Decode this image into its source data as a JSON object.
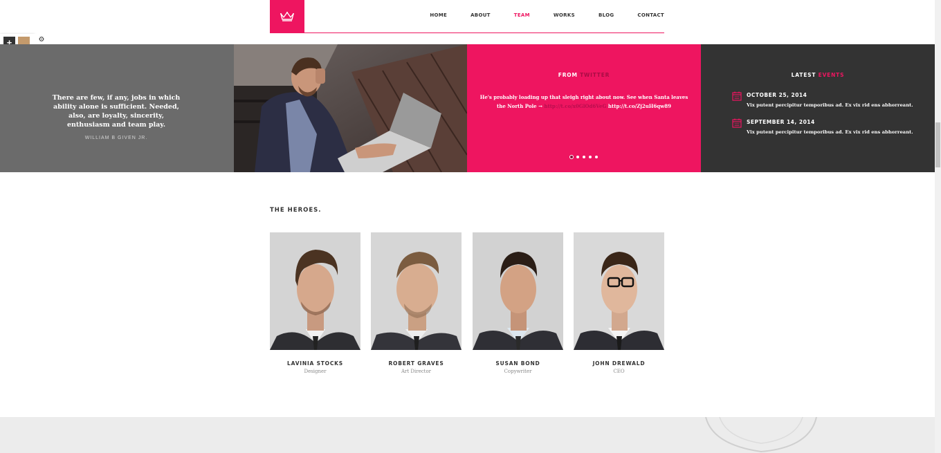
{
  "nav": {
    "items": [
      "HOME",
      "ABOUT",
      "TEAM",
      "WORKS",
      "BLOG",
      "CONTACT"
    ],
    "active": "TEAM"
  },
  "switcher": {
    "swatches": [
      "#c49a6c",
      "#ee1560",
      "#3dccc0",
      "#1e7fa0",
      "#e7d52a",
      "#e8763a",
      "#41c45e",
      "#f03aa8",
      "#6f7f9e",
      "#9a0f1a",
      "#d270d6"
    ]
  },
  "quote": {
    "text": "There are few, if any, jobs in which ability alone is sufficient. Needed, also, are loyalty, sincerity, enthusiasm and team play.",
    "author": "WILLIAM B GIVEN JR."
  },
  "twitter": {
    "title_part1": "FROM",
    "title_part2": "TWITTER",
    "tweet_text": "He's probably loading up that sleigh right about now. See when Santa leaves the North Pole → ",
    "link1": "http://t.co/x0GlOd6VeG",
    "link2": "http://t.co/Zj2uH6qw89"
  },
  "events": {
    "title_part1": "LATEST",
    "title_part2": "EVENTS",
    "items": [
      {
        "date": "OCTOBER 25, 2014",
        "desc": "Vix putent percipitur temporibus ad. Ex vix rid ens abhorreant."
      },
      {
        "date": "SEPTEMBER 14, 2014",
        "desc": "Vix putent percipitur temporibus ad. Ex vix rid ens abhorreant."
      }
    ]
  },
  "team": {
    "title": "THE HEROES.",
    "members": [
      {
        "name": "LAVINIA STOCKS",
        "role": "Designer"
      },
      {
        "name": "ROBERT GRAVES",
        "role": "Art Director"
      },
      {
        "name": "SUSAN BOND",
        "role": "Copywriter"
      },
      {
        "name": "JOHN DREWALD",
        "role": "CEO"
      }
    ]
  },
  "colors": {
    "accent": "#ee1560",
    "dark": "#333333",
    "grey": "#6b6b6b"
  }
}
